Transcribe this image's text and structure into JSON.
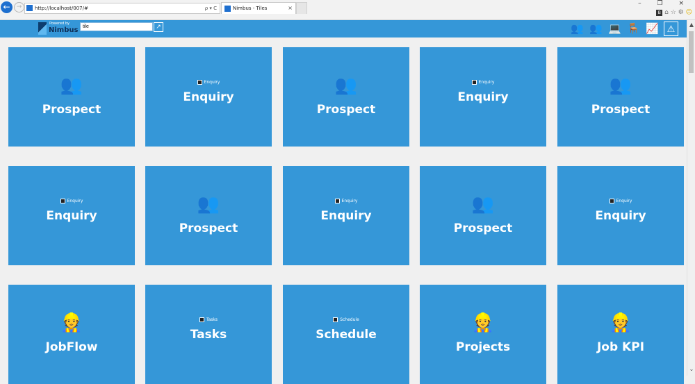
{
  "browser": {
    "url": "http://localhost/007/#",
    "url_controls": "ρ ▾ C",
    "tab_title": "Nimbus - Tiles",
    "tab_close": "×",
    "window_controls": "– ❐ ×",
    "tools": "⌂ ☆ ⚙",
    "tools_b": "B",
    "tools_smile": "☺",
    "back_icon": "arrow-left-icon",
    "forward_icon": "arrow-right-icon"
  },
  "app": {
    "logo_powered": "Powered by",
    "logo_name": "Nimbus",
    "search_value": "tile",
    "search_button_icon": "chart-icon",
    "header_icons": [
      {
        "name": "users-icon",
        "glyph": "👥"
      },
      {
        "name": "users-alt-icon",
        "glyph": "👥"
      },
      {
        "name": "laptop-icon",
        "glyph": "💻"
      },
      {
        "name": "desk-icon",
        "glyph": "🪑"
      },
      {
        "name": "chart-icon",
        "glyph": "📈"
      },
      {
        "name": "alert-icon",
        "glyph": "⚠"
      }
    ],
    "accent_color": "#3597d8"
  },
  "tiles": [
    {
      "type": "icon",
      "label": "Prospect",
      "icon": "people-icon",
      "glyph": "👥"
    },
    {
      "type": "small",
      "label": "Enquiry",
      "small_label": "Enquiry"
    },
    {
      "type": "icon",
      "label": "Prospect",
      "icon": "people-icon",
      "glyph": "👥"
    },
    {
      "type": "small",
      "label": "Enquiry",
      "small_label": "Enquiry"
    },
    {
      "type": "icon",
      "label": "Prospect",
      "icon": "people-icon",
      "glyph": "👥"
    },
    {
      "type": "small",
      "label": "Enquiry",
      "small_label": "Enquiry"
    },
    {
      "type": "icon",
      "label": "Prospect",
      "icon": "people-icon",
      "glyph": "👥"
    },
    {
      "type": "small",
      "label": "Enquiry",
      "small_label": "Enquiry"
    },
    {
      "type": "icon",
      "label": "Prospect",
      "icon": "people-icon",
      "glyph": "👥"
    },
    {
      "type": "small",
      "label": "Enquiry",
      "small_label": "Enquiry"
    },
    {
      "type": "icon",
      "label": "JobFlow",
      "icon": "workers-icon",
      "glyph": "👷"
    },
    {
      "type": "small",
      "label": "Tasks",
      "small_label": "Tasks"
    },
    {
      "type": "small",
      "label": "Schedule",
      "small_label": "Schedule"
    },
    {
      "type": "icon",
      "label": "Projects",
      "icon": "workers-icon",
      "glyph": "👷"
    },
    {
      "type": "icon",
      "label": "Job KPI",
      "icon": "workers-icon",
      "glyph": "👷"
    }
  ]
}
